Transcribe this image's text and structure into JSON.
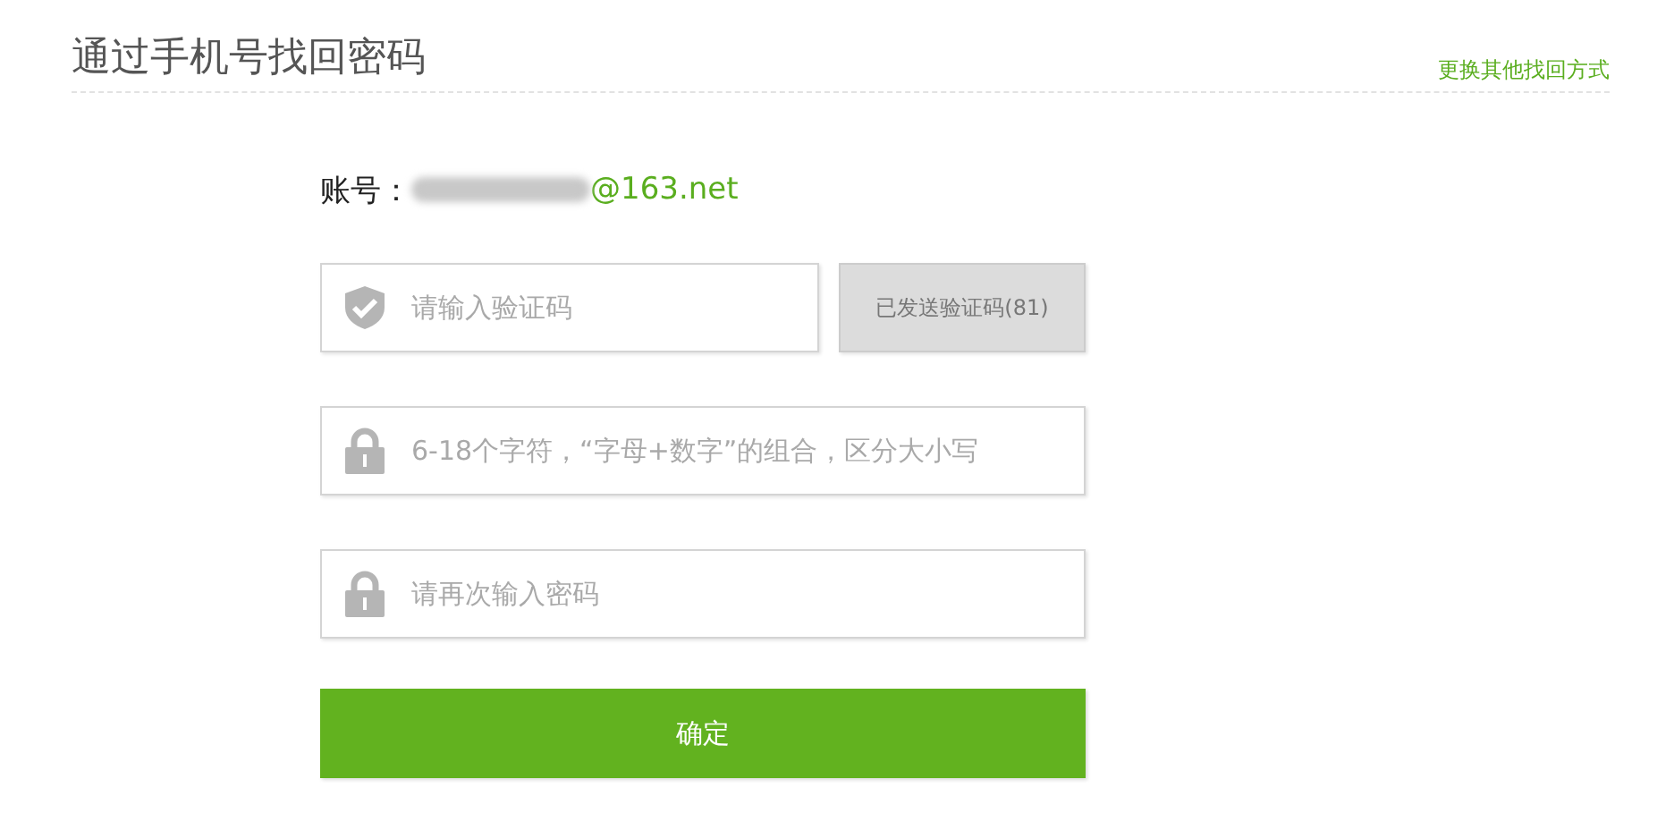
{
  "header": {
    "title": "通过手机号找回密码",
    "alt_link": "更换其他找回方式"
  },
  "account": {
    "label": "账号：",
    "value": "@163.net",
    "redacted": true
  },
  "fields": [
    {
      "kind": "code",
      "placeholder": "请输入验证码",
      "button": {
        "label": "已发送验证码(81)",
        "disabled": true
      }
    },
    {
      "kind": "password",
      "placeholder": "6-18个字符，“字母+数字”的组合，区分大小写"
    },
    {
      "kind": "password",
      "placeholder": "请再次输入密码"
    }
  ],
  "submit": {
    "label": "确定"
  }
}
